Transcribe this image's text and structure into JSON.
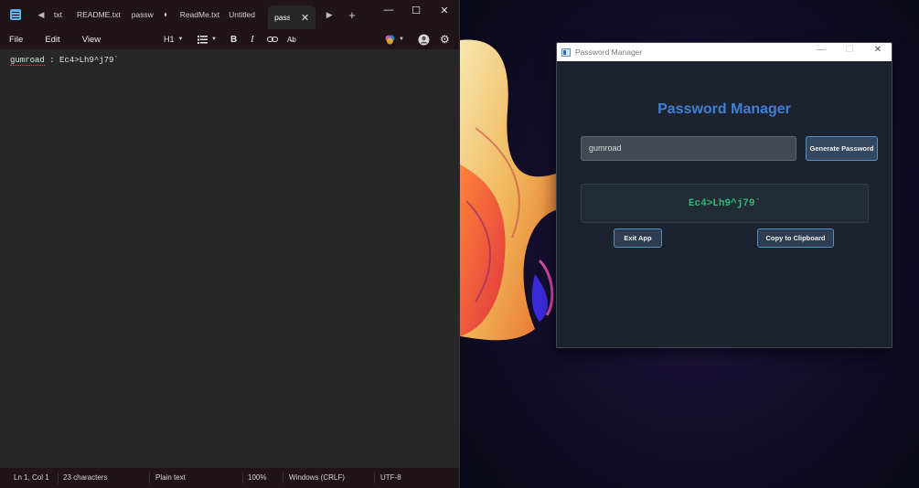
{
  "notepad": {
    "tabs": [
      {
        "label": "txt"
      },
      {
        "label": "README.txt"
      },
      {
        "label": "passw",
        "unsaved": true
      },
      {
        "label": "ReadMe.txt"
      },
      {
        "label": "Untitled"
      },
      {
        "label": "passw",
        "active": true
      }
    ],
    "menu": {
      "file": "File",
      "edit": "Edit",
      "view": "View"
    },
    "format": {
      "heading": "H1"
    },
    "content": {
      "word": "gumroad",
      "rest": " : Ec4>Lh9^j79`"
    },
    "status": {
      "position": "Ln 1, Col 1",
      "characters": "23 characters",
      "format": "Plain text",
      "zoom": "100%",
      "line_ending": "Windows (CRLF)",
      "encoding": "UTF-8"
    }
  },
  "password_manager": {
    "window_title": "Password Manager",
    "heading": "Password Manager",
    "service_input": "gumroad",
    "generate_label": "Generate Password",
    "generated_password": "Ec4>Lh9^j79`",
    "exit_label": "Exit App",
    "copy_label": "Copy to Clipboard"
  },
  "colors": {
    "heading_blue": "#3f7fd8",
    "password_green": "#2cb776",
    "button_border": "#4f8fc9"
  },
  "icons": [
    "notepad-app-icon",
    "minimize-icon",
    "maximize-icon",
    "close-icon",
    "bold-icon",
    "italic-icon",
    "link-icon",
    "spellcheck-icon",
    "list-icon",
    "copilot-icon",
    "account-icon",
    "settings-icon"
  ]
}
